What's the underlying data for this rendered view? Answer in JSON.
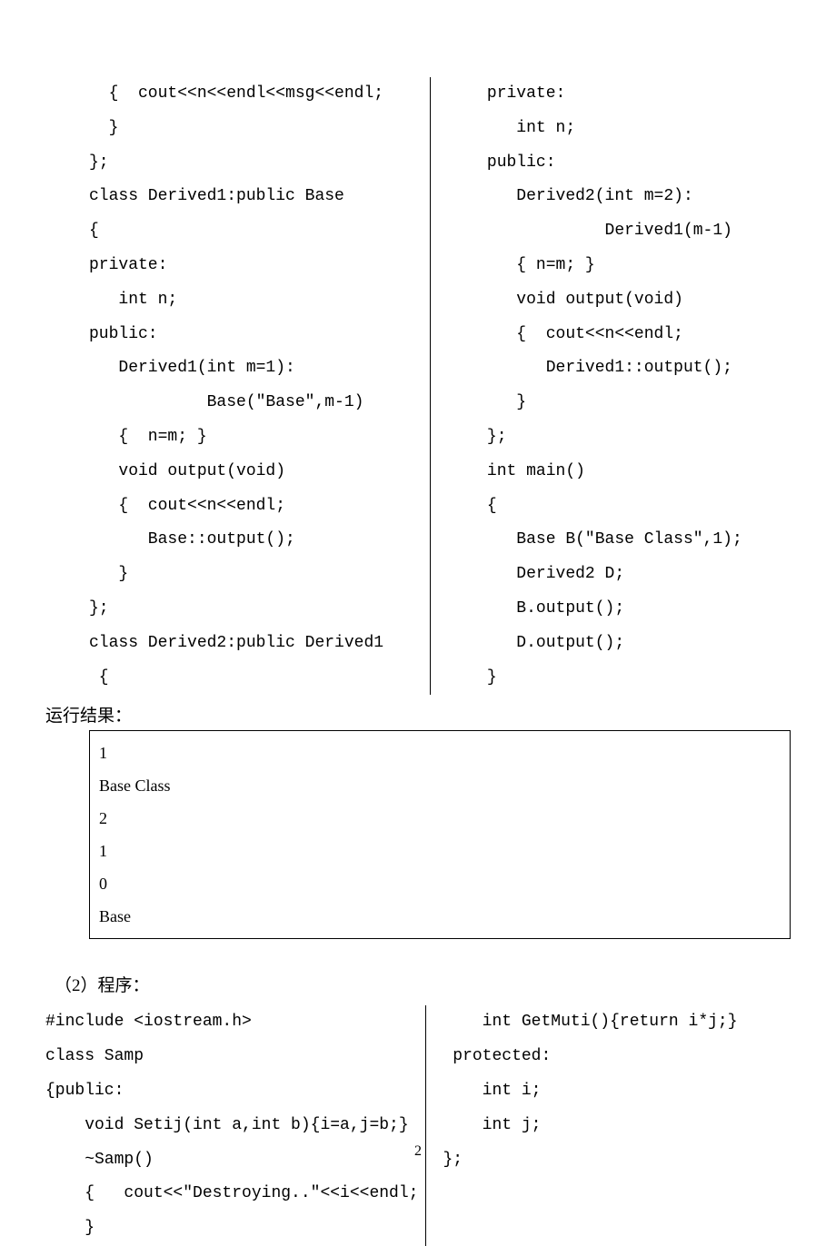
{
  "code1": {
    "left": "  {  cout<<n<<endl<<msg<<endl;\n  }\n};\nclass Derived1:public Base\n{\nprivate:\n   int n;\npublic:\n   Derived1(int m=1):\n            Base(\"Base\",m-1)\n   {  n=m; }\n   void output(void)\n   {  cout<<n<<endl;\n      Base::output();\n   }\n};\nclass Derived2:public Derived1\n {",
    "right": "   private:\n      int n;\n   public:\n      Derived2(int m=2):\n               Derived1(m-1)\n      { n=m; }\n      void output(void)\n      {  cout<<n<<endl;\n         Derived1::output();\n      }\n   };\n   int main()\n   {\n      Base B(\"Base Class\",1);\n      Derived2 D;\n      B.output();\n      D.output();\n   }"
  },
  "result_label": "运行结果：",
  "result_lines": [
    "1",
    "Base Class",
    "2",
    "1",
    "0",
    "Base"
  ],
  "section2_label": "（2）程序：",
  "code2": {
    "left": "#include <iostream.h>\nclass Samp\n{public:\n    void Setij(int a,int b){i=a,j=b;}\n    ~Samp()\n    {   cout<<\"Destroying..\"<<i<<endl;\n    }",
    "right": "    int GetMuti(){return i*j;}\n protected:\n    int i;\n    int j;\n};"
  },
  "page_number": "2"
}
